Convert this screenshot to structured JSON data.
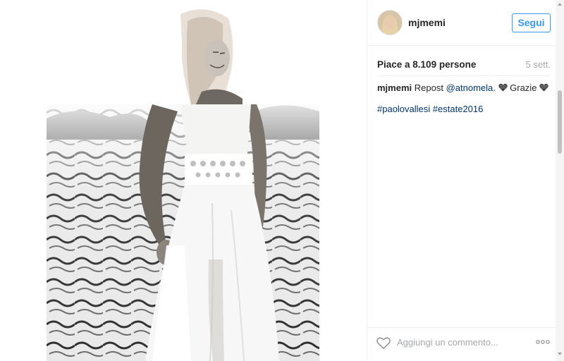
{
  "post": {
    "username": "mjmemi",
    "follow_label": "Segui",
    "likes_text": "Piace a 8.109 persone",
    "time_ago": "5 sett.",
    "caption": {
      "user": "mjmemi",
      "text_before": "Repost",
      "mention": "@atnomela",
      "text_after": ". ",
      "heart_icon": "black-heart-icon",
      "thanks": "Grazie"
    },
    "hashtags": [
      "#paolovallesi",
      "#estate2016"
    ],
    "comment_placeholder": "Aggiungi un commento...",
    "image_description_icon": "photo"
  },
  "colors": {
    "accent": "#3897f0",
    "link": "#003569",
    "muted": "#a5a7aa",
    "text": "#262626"
  }
}
